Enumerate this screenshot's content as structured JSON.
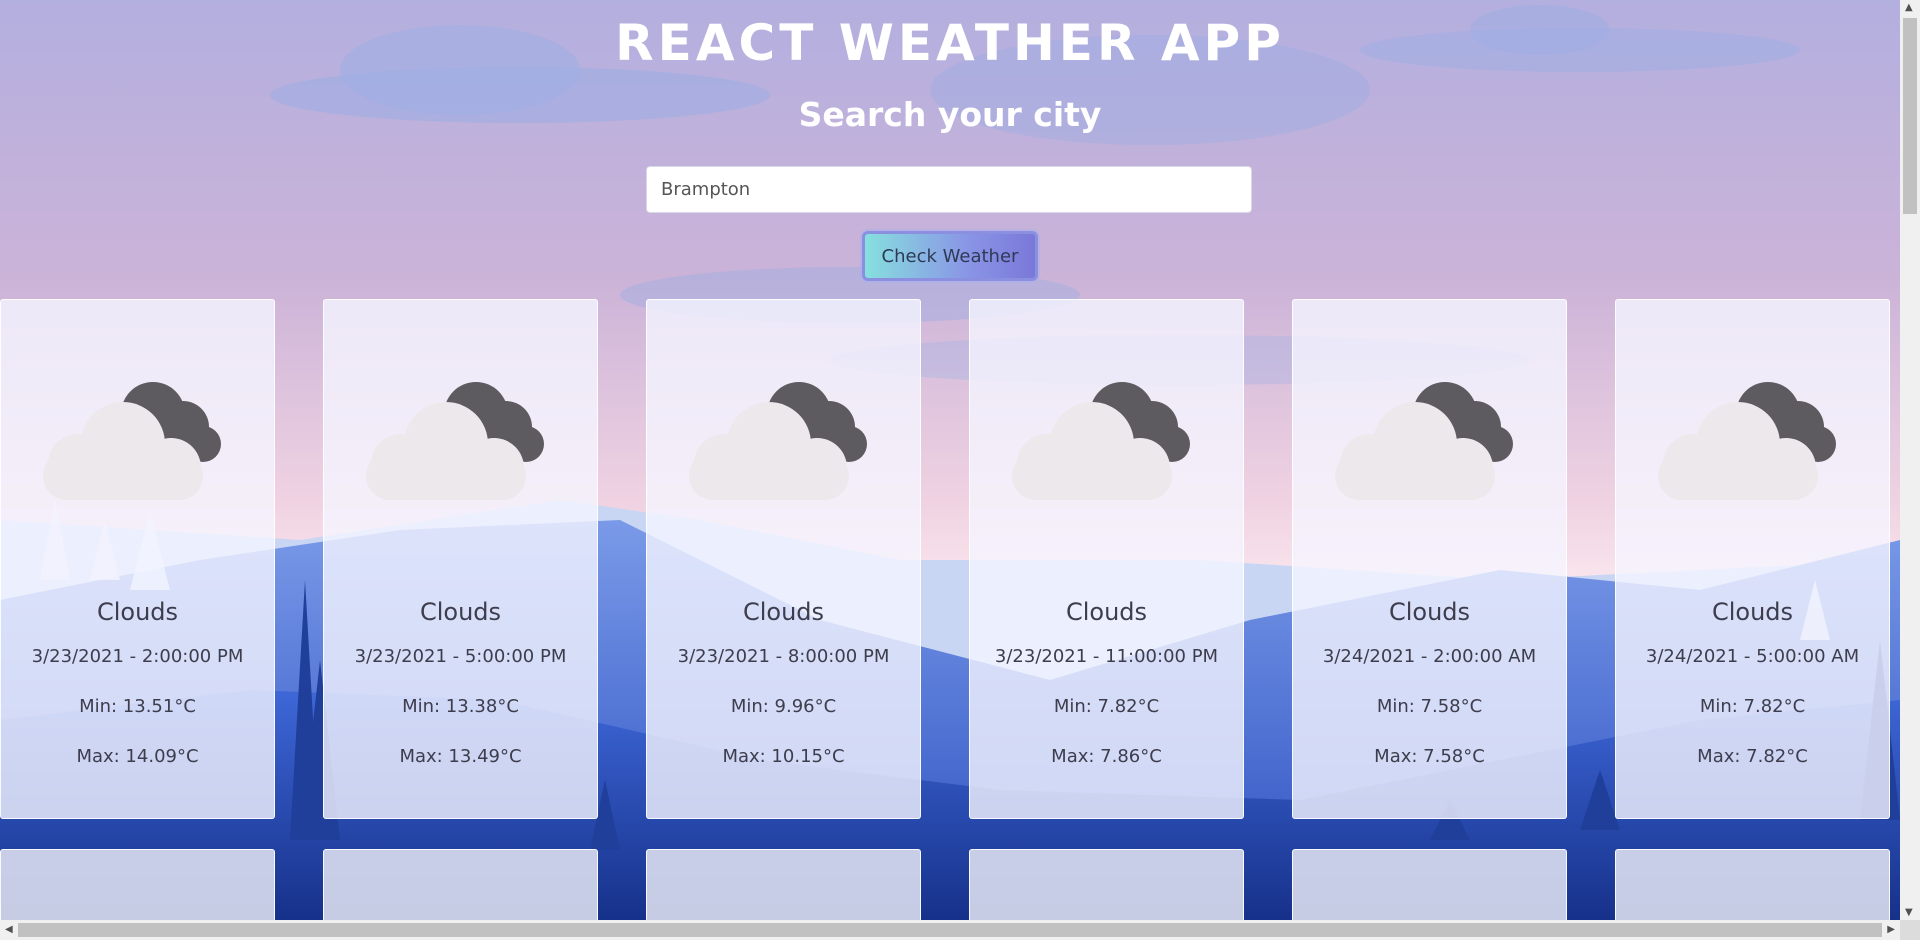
{
  "header": {
    "title": "REACT WEATHER APP",
    "subtitle": "Search your city"
  },
  "search": {
    "value": "Brampton",
    "button_label": "Check Weather"
  },
  "forecast": [
    {
      "description": "Clouds",
      "datetime": "3/23/2021 - 2:00:00 PM",
      "min": "Min: 13.51°C",
      "max": "Max: 14.09°C",
      "icon": "cloud-moon-icon"
    },
    {
      "description": "Clouds",
      "datetime": "3/23/2021 - 5:00:00 PM",
      "min": "Min: 13.38°C",
      "max": "Max: 13.49°C",
      "icon": "cloud-moon-icon"
    },
    {
      "description": "Clouds",
      "datetime": "3/23/2021 - 8:00:00 PM",
      "min": "Min: 9.96°C",
      "max": "Max: 10.15°C",
      "icon": "cloud-moon-icon"
    },
    {
      "description": "Clouds",
      "datetime": "3/23/2021 - 11:00:00 PM",
      "min": "Min: 7.82°C",
      "max": "Max: 7.86°C",
      "icon": "cloud-moon-icon"
    },
    {
      "description": "Clouds",
      "datetime": "3/24/2021 - 2:00:00 AM",
      "min": "Min: 7.58°C",
      "max": "Max: 7.58°C",
      "icon": "cloud-moon-icon"
    },
    {
      "description": "Clouds",
      "datetime": "3/24/2021 - 5:00:00 AM",
      "min": "Min: 7.82°C",
      "max": "Max: 7.82°C",
      "icon": "cloud-moon-icon"
    }
  ],
  "colors": {
    "sky_top": "#b3afdf",
    "sky_bottom": "#f5e4ee",
    "mountain_dark": "#2a4fb8",
    "accent_start": "#86e0de",
    "accent_end": "#7a78d8"
  }
}
